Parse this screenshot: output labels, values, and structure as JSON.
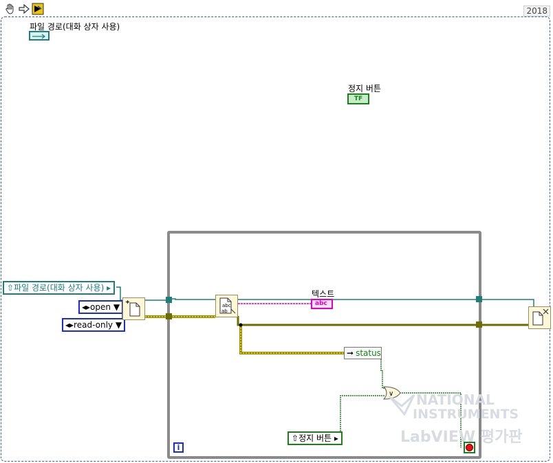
{
  "window": {
    "version": "2018",
    "toolbar_icons": [
      "hand-icon",
      "arrow-right-icon",
      "labview-run-icon"
    ]
  },
  "labels": {
    "file_path_title": "파일 경로(대화 상자 사용)",
    "stop_button_title": "정지 버튼",
    "text_label": "텍스트"
  },
  "terminals": {
    "file_path_terminal": "파일 경로(대화 상자 사용)",
    "open_constant": "open",
    "read_only_constant": "read-only",
    "status_indicator": "status",
    "stop_button_terminal": "정지 버튼",
    "text_indicator_glyph": "abc",
    "bool_glyph": "TF",
    "iteration_glyph": "i"
  },
  "watermark": {
    "line1": "NATIONAL",
    "line2": "INSTRUMENTS",
    "line3": "LabVIEW 평가판"
  },
  "colors": {
    "path_wire": "#1e7f7a",
    "refnum_wire": "#6e6e00",
    "error_wire": "#d4c200",
    "string_wire": "#e000c8",
    "boolean_wire": "#1b7f1b",
    "enum": "#1a2bd6",
    "loop_border": "#8a8a8a"
  }
}
